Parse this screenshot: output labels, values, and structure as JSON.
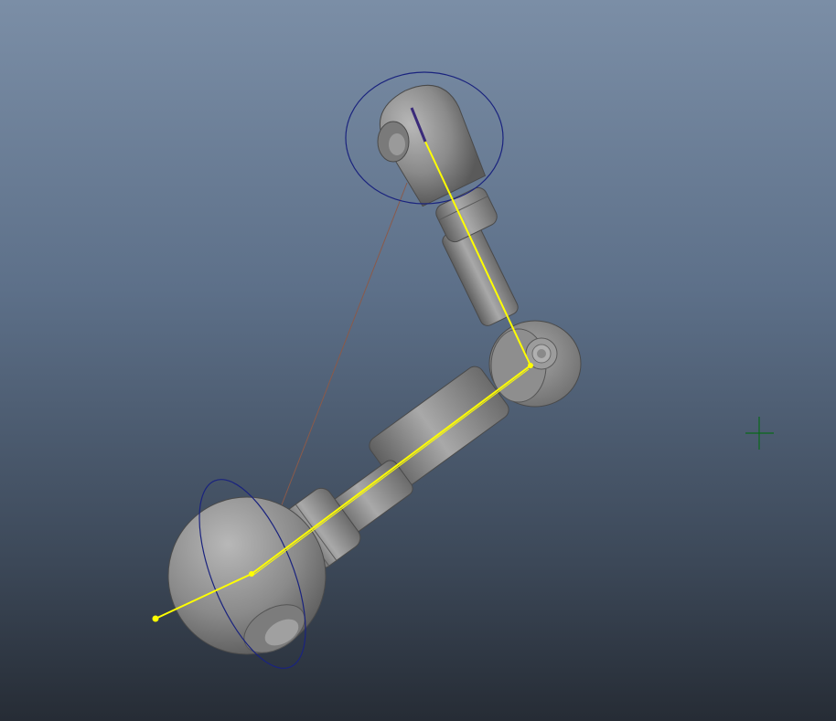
{
  "viewport": {
    "background_top": "#7b8ea6",
    "background_bottom": "#262c35"
  },
  "scene": {
    "object": "mechanical-arm",
    "selection_color": "#ffff00",
    "control_ring_color": "#1a237e",
    "pole_vector_line_color": "#8a5a4a",
    "locator_color": "#0a6a1a",
    "mesh_color": "#8f8f8f"
  }
}
